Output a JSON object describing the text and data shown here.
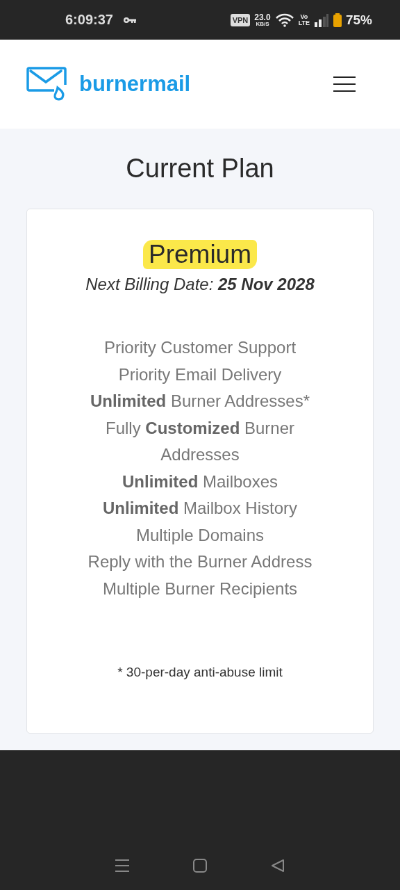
{
  "status_bar": {
    "time": "6:09:37",
    "vpn": "VPN",
    "speed": "23.0",
    "speed_unit": "KB/S",
    "volte_top": "Vo",
    "volte_bottom": "LTE",
    "battery": "75%"
  },
  "header": {
    "brand": "burnermail"
  },
  "page_title": "Current Plan",
  "plan": {
    "name": "Premium",
    "billing_label": "Next Billing Date:",
    "billing_date": "25 Nov 2028",
    "features": [
      "Priority Customer Support",
      "Priority Email Delivery",
      "**Unlimited** Burner Addresses*",
      "Fully **Customized** Burner Addresses",
      "**Unlimited** Mailboxes",
      "**Unlimited** Mailbox History",
      "Multiple Domains",
      "Reply with the Burner Address",
      "Multiple Burner Recipients"
    ],
    "footnote": "* 30-per-day anti-abuse limit"
  }
}
